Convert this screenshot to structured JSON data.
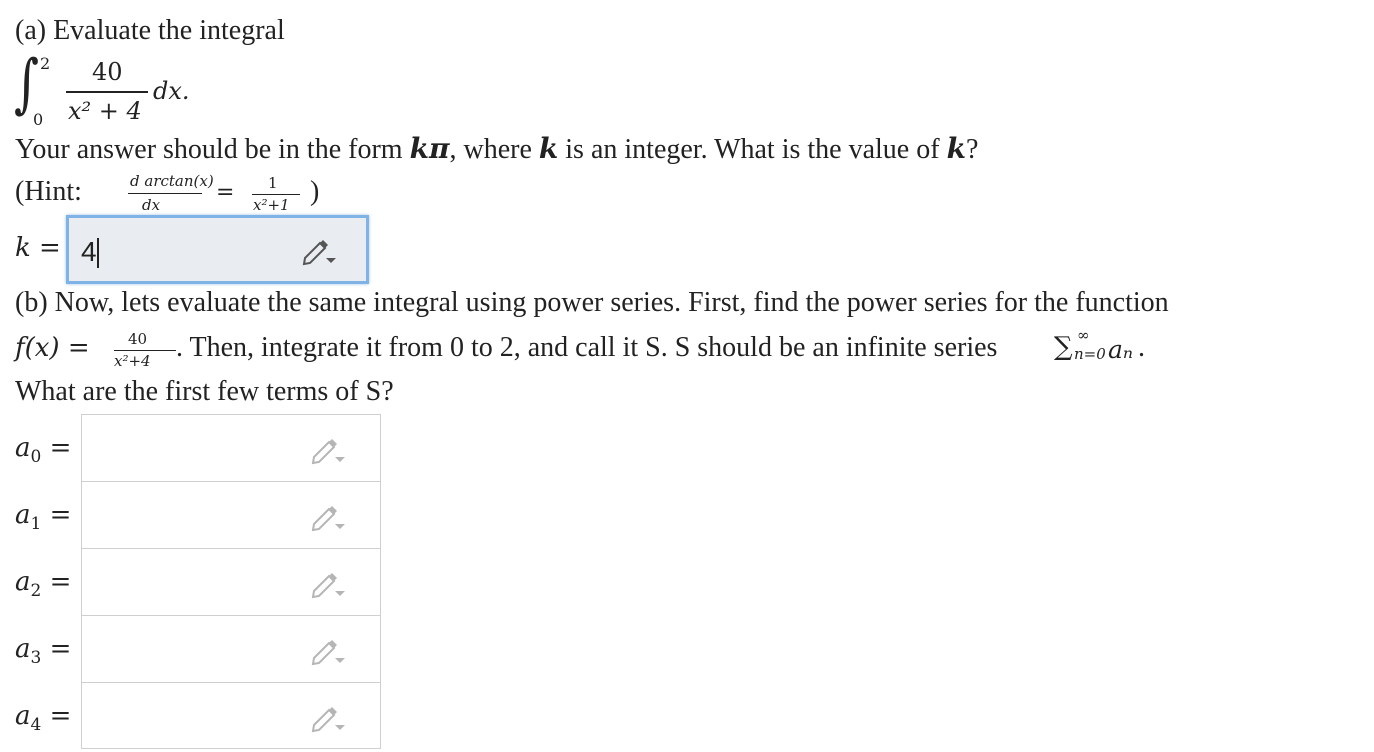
{
  "part_a": {
    "title": "(a) Evaluate the integral",
    "integral": {
      "sign": "∫",
      "upper": "2",
      "lower": "0",
      "numerator": "40",
      "denominator": "x² + 4",
      "differential": "dx."
    },
    "instruction_1": "Your answer should be in the form ",
    "k_pi": "kπ",
    "instruction_2": ", where ",
    "k": "k",
    "instruction_3": " is an integer. What is the value of ",
    "instruction_4": "?",
    "hint_open": "(Hint: ",
    "hint_num": "d arctan(x)",
    "hint_den": "dx",
    "hint_eq": "=",
    "hint_rnum": "1",
    "hint_rden": "x²+1",
    "hint_close": ")",
    "answer_label": "k =",
    "answer_value": "4"
  },
  "part_b": {
    "line1": "(b) Now, lets evaluate the same integral using power series. First, find the power series for the function",
    "fx": "f(x) =",
    "fx_num": "40",
    "fx_den": "x²+4",
    "line2": ". Then, integrate it from 0 to 2, and call it S. S should be an infinite series ",
    "sum_sigma": "∑",
    "sum_upper": "∞",
    "sum_lower": "n=0",
    "sum_term": "aₙ",
    "line2_end": " .",
    "line3": "What are the first few terms of S?",
    "inputs": [
      {
        "label": "a",
        "sub": "0",
        "eq": "=",
        "value": ""
      },
      {
        "label": "a",
        "sub": "1",
        "eq": "=",
        "value": ""
      },
      {
        "label": "a",
        "sub": "2",
        "eq": "=",
        "value": ""
      },
      {
        "label": "a",
        "sub": "3",
        "eq": "=",
        "value": ""
      },
      {
        "label": "a",
        "sub": "4",
        "eq": "=",
        "value": ""
      }
    ]
  },
  "icons": {
    "edit": "pencil-dropdown-icon"
  },
  "colors": {
    "active_border": "#7fb3e6",
    "active_bg": "#e9ecf0",
    "icon_active": "#555555",
    "icon_idle": "#b5b5b5"
  }
}
